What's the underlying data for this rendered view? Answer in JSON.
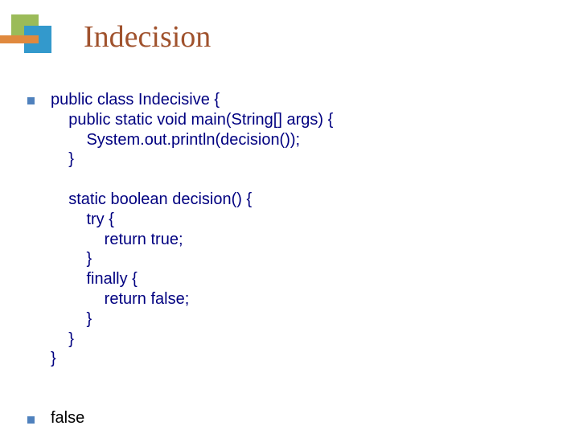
{
  "title": "Indecision",
  "code": "public class Indecisive {\n    public static void main(String[] args) {\n        System.out.println(decision());\n    }\n\n    static boolean decision() {\n        try {\n            return true;\n        }\n        finally {\n            return false;\n        }\n    }\n}",
  "answer": "false"
}
